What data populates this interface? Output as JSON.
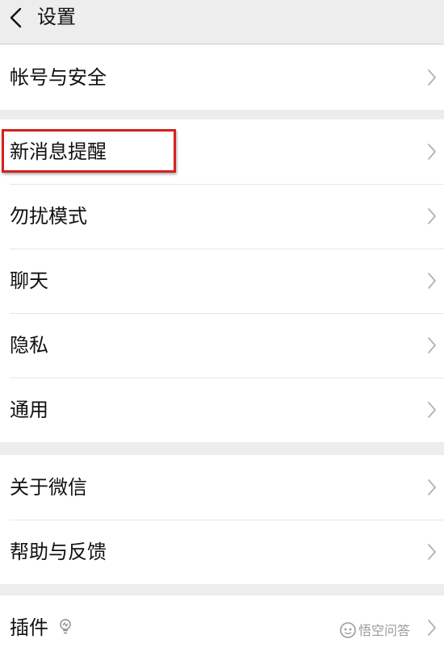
{
  "header": {
    "title": "设置",
    "back_icon": "chevron-left-icon"
  },
  "groups": [
    {
      "items": [
        {
          "label": "帐号与安全"
        }
      ]
    },
    {
      "items": [
        {
          "label": "新消息提醒",
          "highlighted": true
        },
        {
          "label": "勿扰模式"
        },
        {
          "label": "聊天"
        },
        {
          "label": "隐私"
        },
        {
          "label": "通用"
        }
      ]
    },
    {
      "items": [
        {
          "label": "关于微信"
        },
        {
          "label": "帮助与反馈"
        }
      ]
    },
    {
      "items": [
        {
          "label": "插件",
          "icon": "lightbulb-icon"
        }
      ]
    }
  ],
  "watermark": {
    "text": "悟空问答"
  },
  "colors": {
    "background": "#ededed",
    "card": "#ffffff",
    "highlight": "#d7201c",
    "chevron": "#b2b2b2"
  }
}
